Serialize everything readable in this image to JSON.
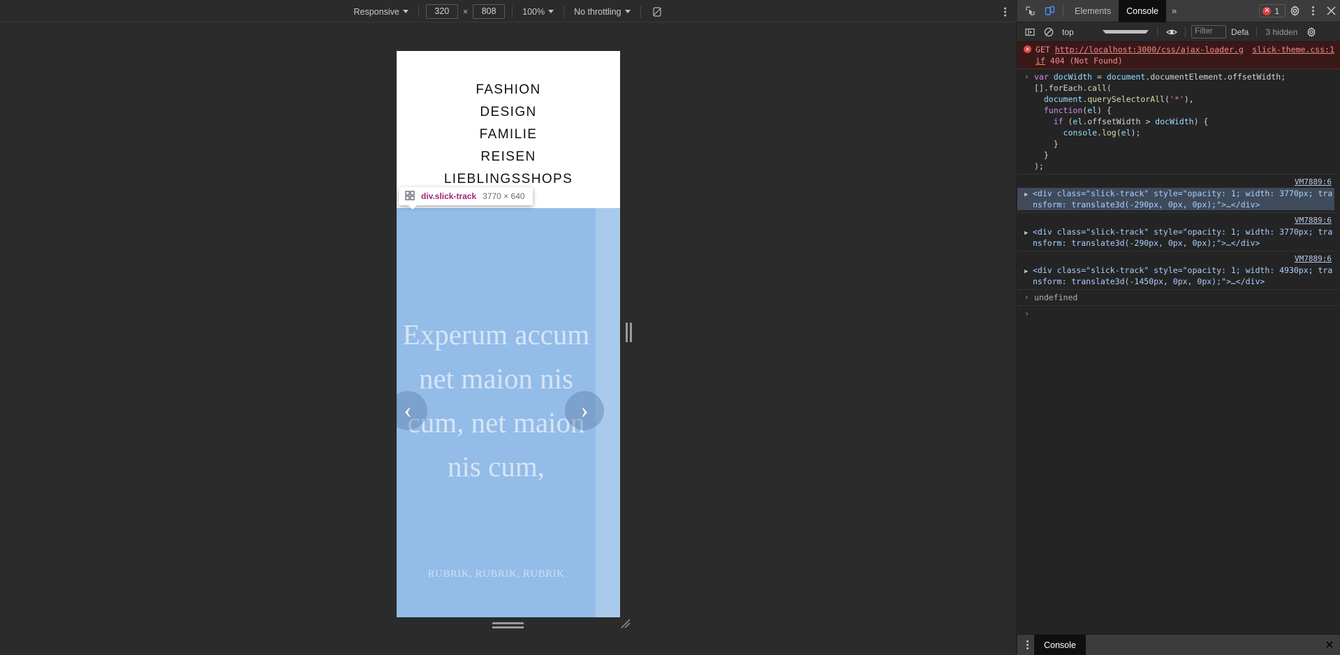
{
  "device_toolbar": {
    "device_label": "Responsive",
    "width": "320",
    "height": "808",
    "x_label": "×",
    "zoom_label": "100%",
    "throttling_label": "No throttling"
  },
  "page": {
    "nav_items": [
      "FASHION",
      "DESIGN",
      "FAMILIE",
      "REISEN",
      "LIEBLINGSSHOPS"
    ],
    "slider": {
      "headline": "Experum accum net maion nis cum, net maion nis cum,",
      "subline": "RUBRIK, RUBRIK, RUBRIK",
      "prev_glyph": "‹",
      "next_glyph": "›"
    }
  },
  "inspector_tooltip": {
    "selector": "div.slick-track",
    "size": "3770 × 640"
  },
  "devtools": {
    "tabs": [
      {
        "label": "Elements",
        "active": false
      },
      {
        "label": "Console",
        "active": true
      }
    ],
    "more_tabs_glyph": "»",
    "error_count": "1",
    "console_toolbar": {
      "context": "top",
      "filter_placeholder": "Filter",
      "level_label": "Defa",
      "hidden_label": "3 hidden"
    },
    "messages": [
      {
        "kind": "error",
        "method": "GET",
        "url": "http://localhost:3000/css/ajax-loader.gif",
        "status": "404 (Not Found)",
        "source": "slick-theme.css:1"
      },
      {
        "kind": "input",
        "lines": [
          "var docWidth = document.documentElement.offsetWidth;",
          "[].forEach.call(",
          "  document.querySelectorAll('*'),",
          "  function(el) {",
          "    if (el.offsetWidth > docWidth) {",
          "      console.log(el);",
          "    }",
          "  }",
          ");"
        ]
      },
      {
        "kind": "node",
        "source": "VM7889:6",
        "selected": true,
        "text": "<div class=\"slick-track\" style=\"opacity: 1; width: 3770px; transform: translate3d(-290px, 0px, 0px);\">…</div>"
      },
      {
        "kind": "node",
        "source": "VM7889:6",
        "selected": false,
        "text": "<div class=\"slick-track\" style=\"opacity: 1; width: 3770px; transform: translate3d(-290px, 0px, 0px);\">…</div>"
      },
      {
        "kind": "node",
        "source": "VM7889:6",
        "selected": false,
        "text": "<div class=\"slick-track\" style=\"opacity: 1; width: 4930px; transform: translate3d(-1450px, 0px, 0px);\">…</div>"
      },
      {
        "kind": "result",
        "text": "undefined"
      }
    ],
    "prompt_glyph": "›",
    "drawer": {
      "tab_label": "Console",
      "close_glyph": "✕"
    }
  },
  "colors": {
    "devtools_bg": "#242424",
    "tabbar_bg": "#3c3c3c",
    "accent_blue": "#4f8ef7",
    "error_red": "#e03f3f",
    "slider_blue": "#93bce8",
    "selected_node": "#3f4a5a"
  }
}
